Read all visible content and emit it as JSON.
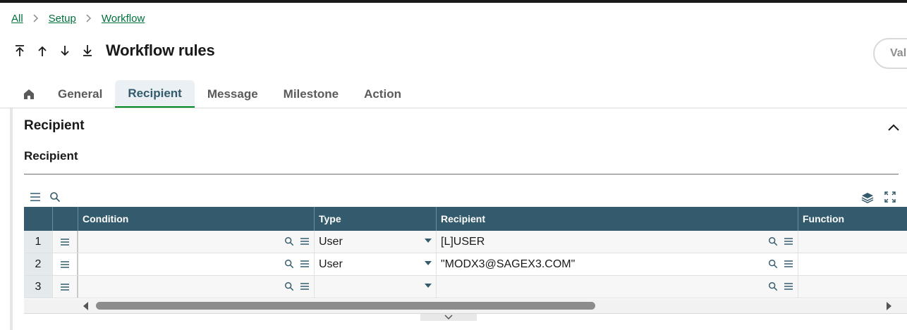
{
  "breadcrumb": {
    "items": [
      "All",
      "Setup",
      "Workflow"
    ]
  },
  "page": {
    "title": "Workflow rules",
    "val_button": "Val"
  },
  "tabs": [
    "General",
    "Recipient",
    "Message",
    "Milestone",
    "Action"
  ],
  "active_tab": "Recipient",
  "section": {
    "title": "Recipient",
    "subtitle": "Recipient"
  },
  "grid": {
    "columns": [
      "Condition",
      "Type",
      "Recipient",
      "Function"
    ],
    "rows": [
      {
        "num": "1",
        "condition": "",
        "type": "User",
        "recipient": "[L]USER",
        "function": ""
      },
      {
        "num": "2",
        "condition": "",
        "type": "User",
        "recipient": "\"MODX3@SAGEX3.COM\"",
        "function": ""
      },
      {
        "num": "3",
        "condition": "",
        "type": "",
        "recipient": "",
        "function": ""
      }
    ]
  },
  "colors": {
    "header": "#335b6d",
    "link": "#00703c",
    "active_tab_underline": "#008a21"
  },
  "icons": [
    "home-icon",
    "first-record-icon",
    "previous-record-icon",
    "next-record-icon",
    "last-record-icon",
    "collapse-chevron-icon",
    "menu-icon",
    "search-icon",
    "layers-icon",
    "fullscreen-icon",
    "dropdown-arrow-icon"
  ]
}
